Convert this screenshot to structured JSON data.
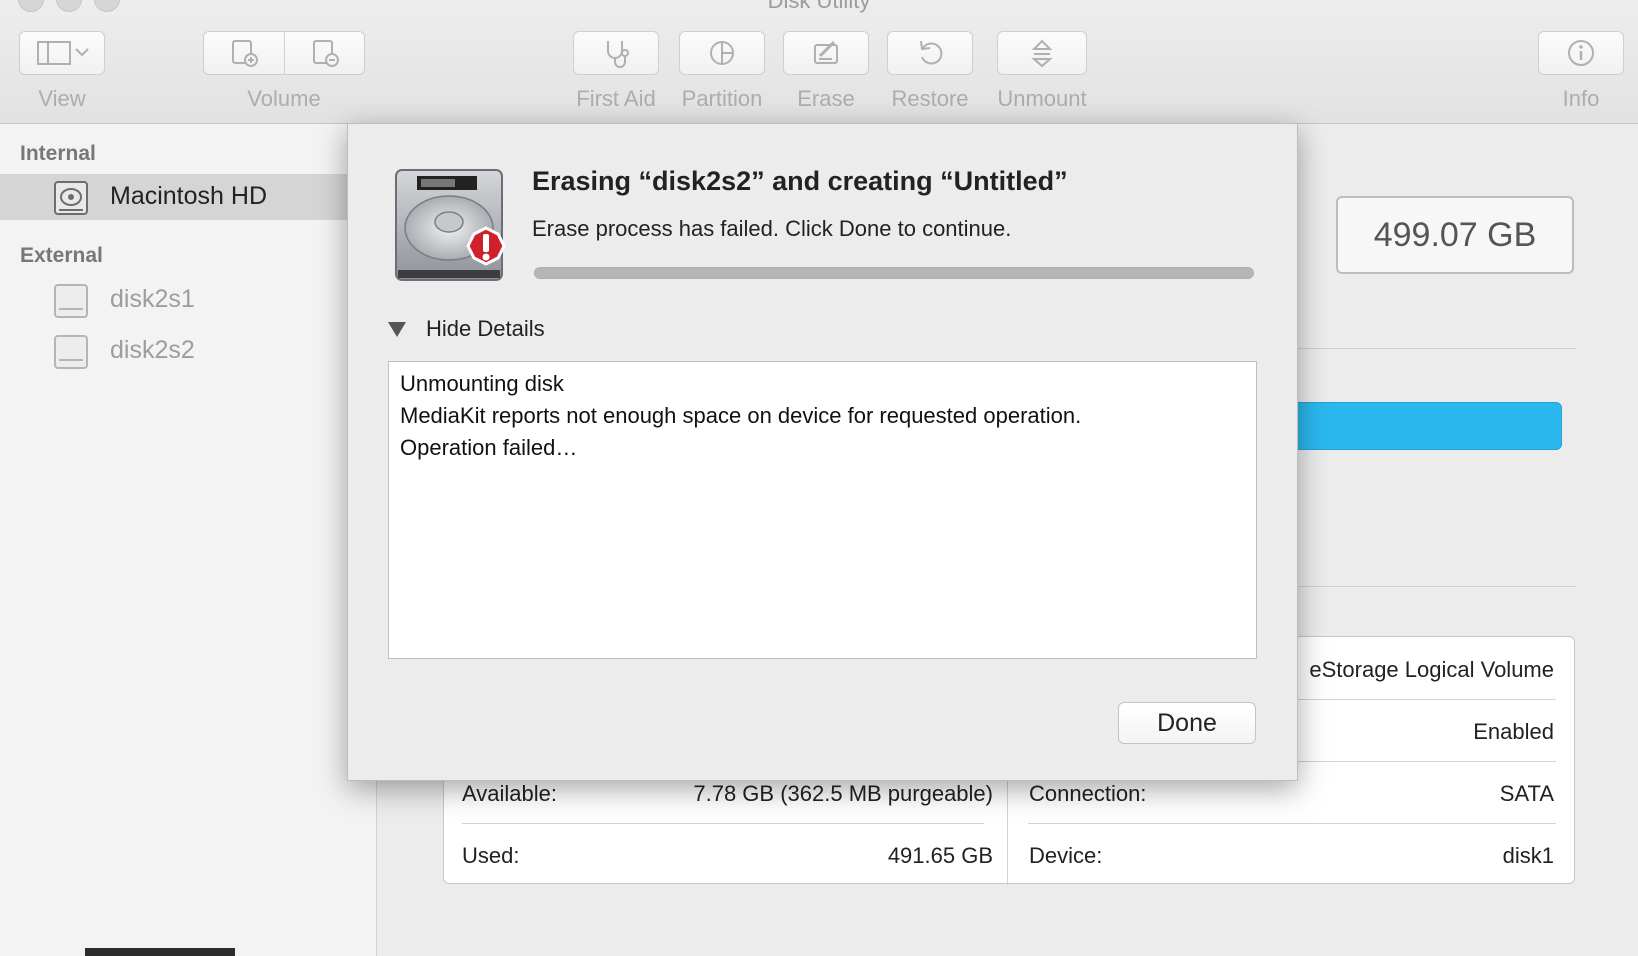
{
  "window": {
    "title": "Disk Utility"
  },
  "toolbar": {
    "view_label": "View",
    "volume_label": "Volume",
    "first_aid_label": "First Aid",
    "partition_label": "Partition",
    "erase_label": "Erase",
    "restore_label": "Restore",
    "unmount_label": "Unmount",
    "info_label": "Info"
  },
  "sidebar": {
    "internal_header": "Internal",
    "external_header": "External",
    "internal_items": [
      {
        "label": "Macintosh HD",
        "selected": true
      }
    ],
    "external_items": [
      {
        "label": "disk2s1"
      },
      {
        "label": "disk2s2"
      }
    ]
  },
  "main": {
    "capacity": "499.07 GB",
    "usage_color": "#2bb8ee",
    "info": {
      "type_value": "eStorage Logical Volume",
      "owners_value": "Enabled",
      "available_label": "Available:",
      "available_value": "7.78 GB (362.5 MB purgeable)",
      "connection_label": "Connection:",
      "connection_value": "SATA",
      "used_label": "Used:",
      "used_value": "491.65 GB",
      "device_label": "Device:",
      "device_value": "disk1"
    }
  },
  "sheet": {
    "title": "Erasing “disk2s2” and creating “Untitled”",
    "message": "Erase process has failed. Click Done to continue.",
    "details_toggle": "Hide Details",
    "log_lines": [
      "Unmounting disk",
      "MediaKit reports not enough space on device for requested operation.",
      "Operation failed…"
    ],
    "done_label": "Done",
    "error_color": "#d0202a"
  }
}
